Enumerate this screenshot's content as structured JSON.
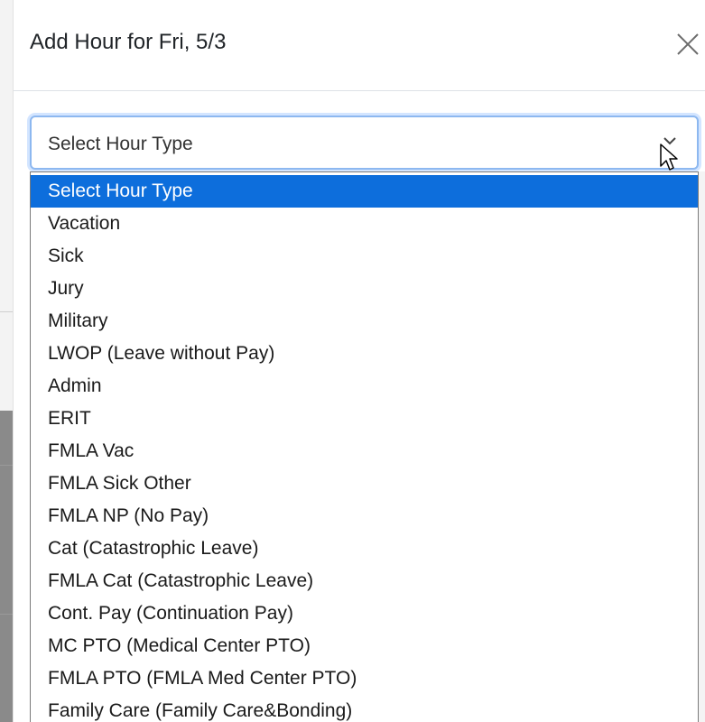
{
  "modal": {
    "title": "Add Hour for Fri, 5/3",
    "close_icon": "close-icon"
  },
  "hour_type_select": {
    "selected_value": "Select Hour Type",
    "chevron_icon": "chevron-down-icon",
    "accent_color": "#0d6edc",
    "options": [
      "Select Hour Type",
      "Vacation",
      "Sick",
      "Jury",
      "Military",
      "LWOP (Leave without Pay)",
      "Admin",
      "ERIT",
      "FMLA Vac",
      "FMLA Sick Other",
      "FMLA NP (No Pay)",
      "Cat (Catastrophic Leave)",
      "FMLA Cat (Catastrophic Leave)",
      "Cont. Pay (Continuation Pay)",
      "MC PTO (Medical Center PTO)",
      "FMLA PTO (FMLA Med Center PTO)",
      "Family Care (Family Care&Bonding)"
    ]
  }
}
